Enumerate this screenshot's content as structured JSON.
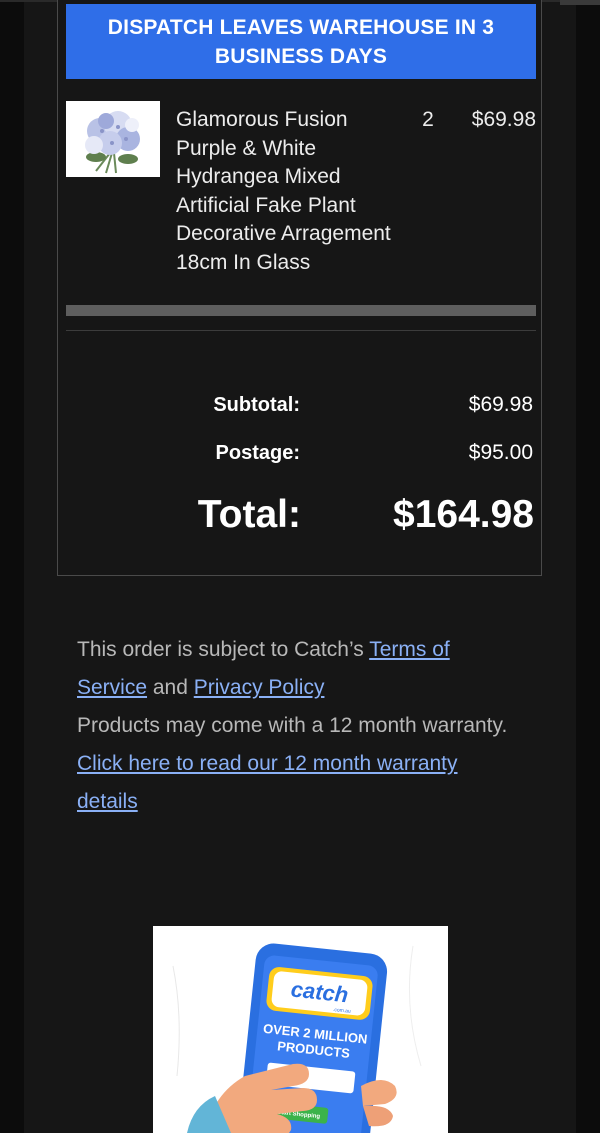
{
  "banner": {
    "text": "DISPATCH LEAVES WAREHOUSE IN 3 BUSINESS DAYS"
  },
  "item": {
    "image_icon": "hydrangea-photo",
    "name": "Glamorous Fusion Purple & White Hydrangea Mixed Artificial Fake Plant Decorative Arragement 18cm In Glass",
    "qty": "2",
    "price": "$69.98"
  },
  "summary": {
    "subtotal_label": "Subtotal:",
    "subtotal_value": "$69.98",
    "postage_label": "Postage:",
    "postage_value": "$95.00",
    "total_label": "Total:",
    "total_value": "$164.98"
  },
  "footer": {
    "intro": "This order is subject to Catch’s ",
    "terms_link": "Terms of Service",
    "and": " and ",
    "privacy_link": "Privacy Policy",
    "warranty_text": "Products may come with a 12 month warranty.",
    "warranty_link": "Click here to read our 12 month warranty details"
  },
  "promo": {
    "logo_text": "catch",
    "logo_sub": ".com.au",
    "headline_line1": "OVER 2 MILLION",
    "headline_line2": "PRODUCTS",
    "cta": "Start Shopping"
  },
  "colors": {
    "background": "#111111",
    "banner": "#2f6ee8",
    "link": "#8ab0f5",
    "catch_blue": "#2a6fe0",
    "catch_yellow": "#ffcd1c"
  }
}
